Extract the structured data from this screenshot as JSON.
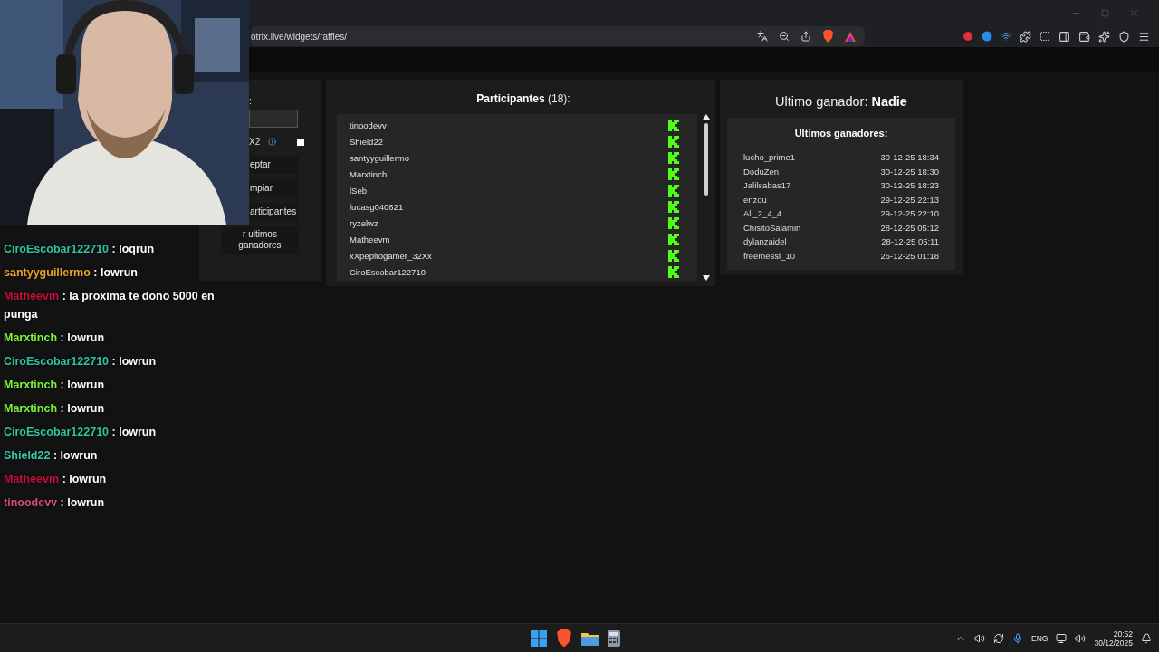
{
  "browser": {
    "url": "otrix.live/widgets/raffles/"
  },
  "raffle_controls": {
    "label": ":",
    "option": {
      "label": "X2",
      "checked": false
    },
    "buttons": [
      "eptar",
      "mpiar",
      "articipantes",
      "r ultimos ganadores"
    ]
  },
  "participants": {
    "title": "**Participantes** (18):",
    "items": [
      "tinoodevv",
      "Shield22",
      "santyyguillermo",
      "Marxtinch",
      "lSeb",
      "lucasg040621",
      "ryzelwz",
      "Matheevm",
      "xXpepitogamer_32Xx",
      "CiroEscobar122710"
    ]
  },
  "winner": {
    "heading": "Ultimo ganador: **Nadie**"
  },
  "recent_winners": {
    "title": "Ultimos ganadores:",
    "rows": [
      {
        "name": "lucho_prime1",
        "date": "30-12-25 18:34"
      },
      {
        "name": "DoduZen",
        "date": "30-12-25 18:30"
      },
      {
        "name": "Jalilsabas17",
        "date": "30-12-25 18:23"
      },
      {
        "name": "enzou",
        "date": "29-12-25 22:13"
      },
      {
        "name": "Ali_2_4_4",
        "date": "29-12-25 22:10"
      },
      {
        "name": "ChisitoSalamin",
        "date": "28-12-25 05:12"
      },
      {
        "name": "dylanzaidel",
        "date": "28-12-25 05:11"
      },
      {
        "name": "freemessi_10",
        "date": "26-12-25 01:18"
      }
    ]
  },
  "chat": [
    {
      "user": "CiroEscobar122710",
      "color": "#2fc4a2",
      "message": ": loqrun"
    },
    {
      "user": "santyyguillermo",
      "color": "#e8a428",
      "message": ": lowrun"
    },
    {
      "user": "Matheevm",
      "color": "#c4103c",
      "message": ": la proxima te dono 5000 en punga"
    },
    {
      "user": "Marxtinch",
      "color": "#7cf23a",
      "message": ": lowrun"
    },
    {
      "user": "CiroEscobar122710",
      "color": "#2fc4a2",
      "message": ": lowrun"
    },
    {
      "user": "Marxtinch",
      "color": "#7cf23a",
      "message": ": lowrun"
    },
    {
      "user": "Marxtinch",
      "color": "#7cf23a",
      "message": ": lowrun"
    },
    {
      "user": "CiroEscobar122710",
      "color": "#2fc4a2",
      "message": ": lowrun"
    },
    {
      "user": "Shield22",
      "color": "#3cc8a8",
      "message": ": lowrun"
    },
    {
      "user": "Matheevm",
      "color": "#c4103c",
      "message": ": lowrun"
    },
    {
      "user": "tinoodevv",
      "color": "#d2507e",
      "message": ": lowrun"
    }
  ],
  "taskbar": {
    "language": "ENG",
    "time": "20:52",
    "date": "30/12/2025"
  }
}
